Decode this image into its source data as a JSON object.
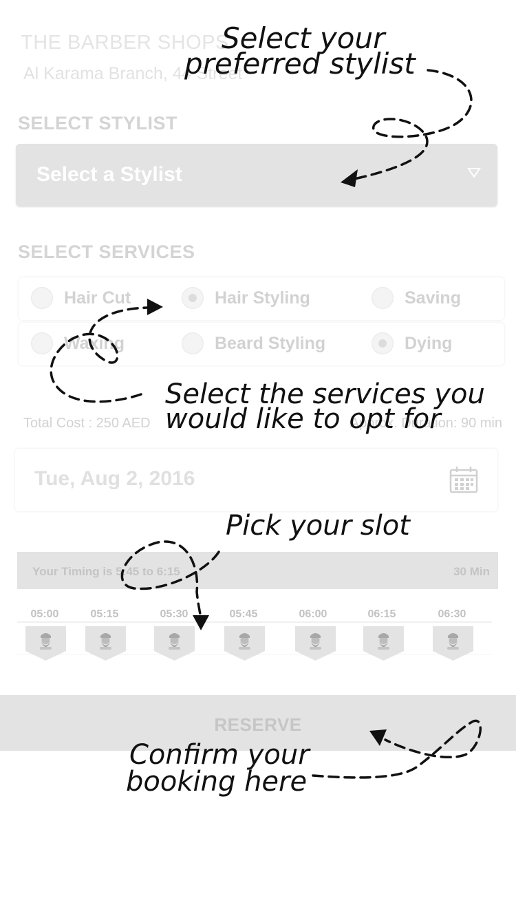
{
  "header": {
    "shop_name": "THE BARBER SHOPS",
    "branch": "Al Karama Branch, 44 Street"
  },
  "stylist": {
    "section_label": "SELECT STYLIST",
    "placeholder": "Select a Stylist",
    "caret_icon": "triangle-down-icon"
  },
  "services": {
    "section_label": "SELECT SERVICES",
    "rows": [
      [
        {
          "label": "Hair Cut",
          "selected": false
        },
        {
          "label": "Hair Styling",
          "selected": true
        },
        {
          "label": "Saving",
          "selected": false
        }
      ],
      [
        {
          "label": "Waxing",
          "selected": false
        },
        {
          "label": "Beard Styling",
          "selected": false
        },
        {
          "label": "Dying",
          "selected": true
        }
      ]
    ]
  },
  "summary": {
    "total_cost": "Total Cost : 250 AED",
    "duration": "Approx. Duration: 90 min"
  },
  "date": {
    "value": "Tue, Aug 2, 2016",
    "icon": "calendar-icon"
  },
  "timing": {
    "text": "Your Timing is 5:45 to 6:15",
    "length": "30 Min",
    "slots": [
      "05:00",
      "05:15",
      "05:30",
      "05:45",
      "06:00",
      "06:15",
      "06:30"
    ],
    "slot_icon": "barber-avatar-icon"
  },
  "reserve": {
    "label": "RESERVE"
  },
  "hints": {
    "stylist_line1": "Select your",
    "stylist_line2": "preferred stylist",
    "services_line1": "Select the services you",
    "services_line2": "would like to opt for",
    "slot": "Pick your slot",
    "confirm_line1": "Confirm your",
    "confirm_line2": "booking here"
  },
  "colors": {
    "panel_gray": "#e3e3e3",
    "faded_text": "#d2d2d2",
    "hint_text": "#111111"
  }
}
